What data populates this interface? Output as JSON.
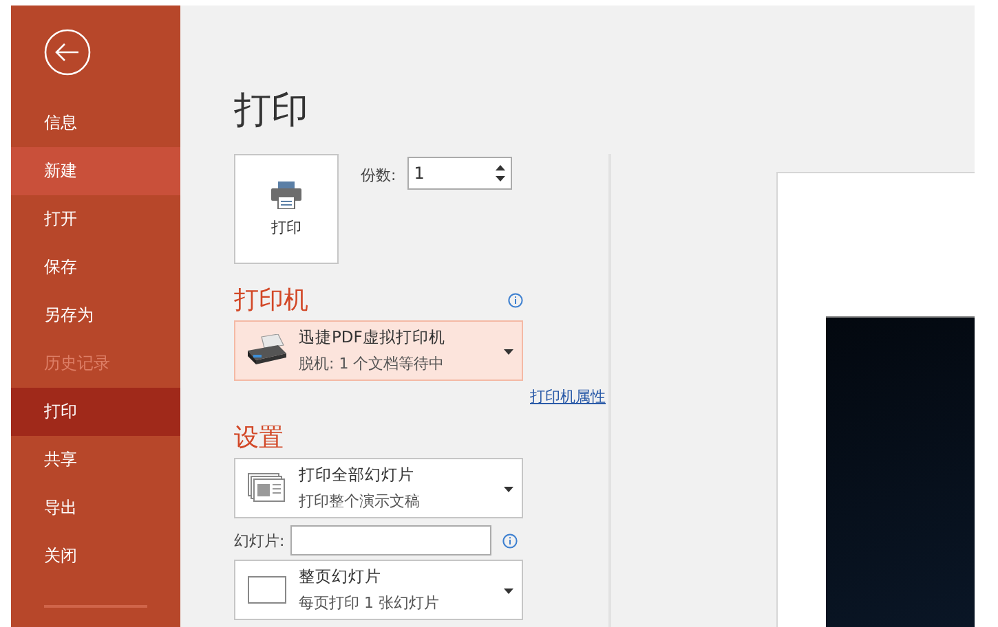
{
  "sidebar": {
    "items": [
      {
        "label": "信息",
        "selected": false,
        "hovered": false,
        "disabled": false
      },
      {
        "label": "新建",
        "selected": false,
        "hovered": true,
        "disabled": false
      },
      {
        "label": "打开",
        "selected": false,
        "hovered": false,
        "disabled": false
      },
      {
        "label": "保存",
        "selected": false,
        "hovered": false,
        "disabled": false
      },
      {
        "label": "另存为",
        "selected": false,
        "hovered": false,
        "disabled": false
      },
      {
        "label": "历史记录",
        "selected": false,
        "hovered": false,
        "disabled": true
      },
      {
        "label": "打印",
        "selected": true,
        "hovered": false,
        "disabled": false
      },
      {
        "label": "共享",
        "selected": false,
        "hovered": false,
        "disabled": false
      },
      {
        "label": "导出",
        "selected": false,
        "hovered": false,
        "disabled": false
      },
      {
        "label": "关闭",
        "selected": false,
        "hovered": false,
        "disabled": false
      }
    ]
  },
  "title": "打印",
  "print_button": {
    "label": "打印"
  },
  "copies": {
    "label": "份数:",
    "value": "1"
  },
  "printer": {
    "heading": "打印机",
    "name": "迅捷PDF虚拟打印机",
    "status": "脱机: 1 个文档等待中",
    "properties_link": "打印机属性"
  },
  "settings": {
    "heading": "设置",
    "dropdowns": [
      {
        "kind": "slides",
        "title": "打印全部幻灯片",
        "subtitle": "打印整个演示文稿"
      },
      {
        "kind": "layout",
        "title": "整页幻灯片",
        "subtitle": "每页打印 1 张幻灯片"
      }
    ],
    "slides_field": {
      "label": "幻灯片:"
    }
  }
}
